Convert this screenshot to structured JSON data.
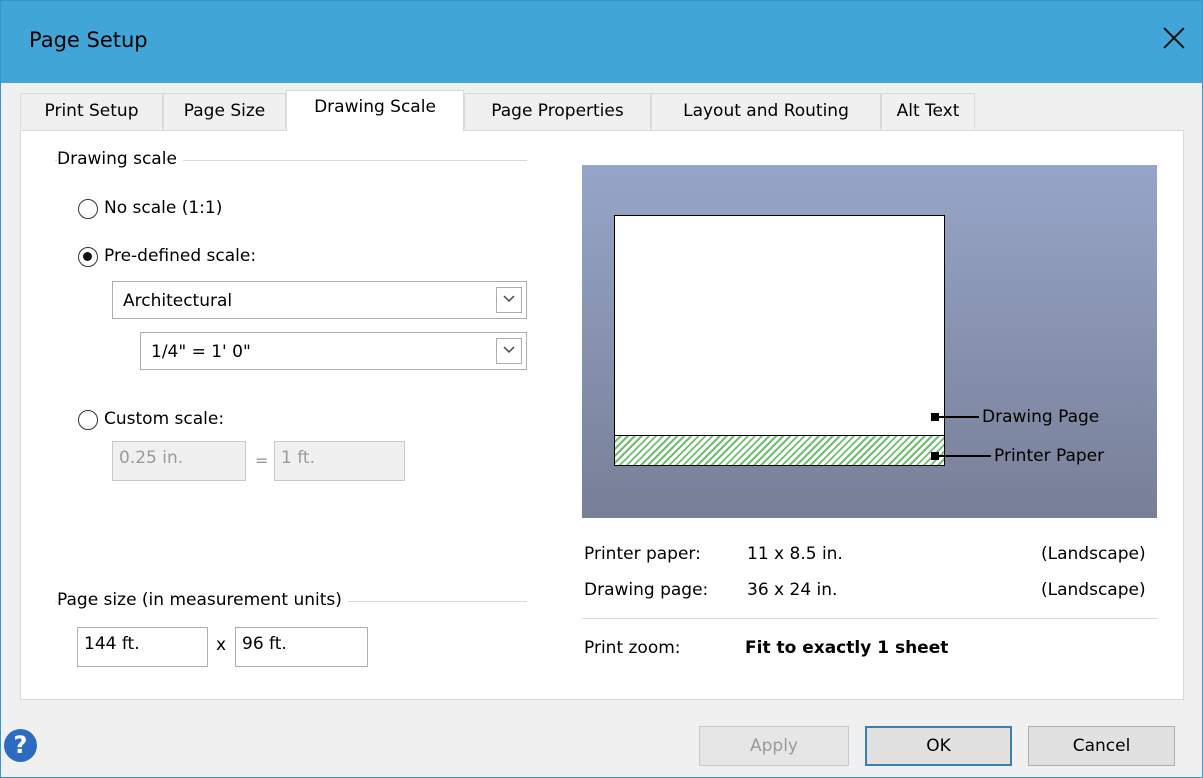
{
  "window": {
    "title": "Page Setup"
  },
  "tabs": [
    {
      "label": "Print Setup"
    },
    {
      "label": "Page Size"
    },
    {
      "label": "Drawing Scale"
    },
    {
      "label": "Page Properties"
    },
    {
      "label": "Layout and Routing"
    },
    {
      "label": "Alt Text"
    }
  ],
  "active_tab": "Drawing Scale",
  "drawing_scale": {
    "group_label": "Drawing scale",
    "no_scale_label": "No scale (1:1)",
    "predefined_label": "Pre-defined scale:",
    "predefined_selected": true,
    "scale_type_value": "Architectural",
    "scale_value": "1/4\" = 1' 0\"",
    "custom_label": "Custom scale:",
    "custom_left_value": "0.25 in.",
    "custom_equals": "=",
    "custom_right_value": "1 ft."
  },
  "page_size": {
    "group_label": "Page size (in measurement units)",
    "width_value": "144 ft.",
    "times": "x",
    "height_value": "96 ft."
  },
  "preview": {
    "drawing_page_label": "Drawing Page",
    "printer_paper_label": "Printer Paper",
    "colors": {
      "hatch": "#6dbf6d",
      "background_top": "#96a5c8",
      "background_bottom": "#787f97"
    }
  },
  "info": {
    "printer_paper_label": "Printer paper:",
    "printer_paper_value": "11 x 8.5 in.",
    "printer_paper_orientation": "(Landscape)",
    "drawing_page_label": "Drawing page:",
    "drawing_page_value": "36 x 24 in.",
    "drawing_page_orientation": "(Landscape)",
    "print_zoom_label": "Print zoom:",
    "print_zoom_value": "Fit to exactly 1 sheet"
  },
  "footer": {
    "help_glyph": "?",
    "apply_label": "Apply",
    "ok_label": "OK",
    "cancel_label": "Cancel"
  },
  "colors": {
    "titlebar": "#41a5d7",
    "help": "#2b6cc0"
  }
}
